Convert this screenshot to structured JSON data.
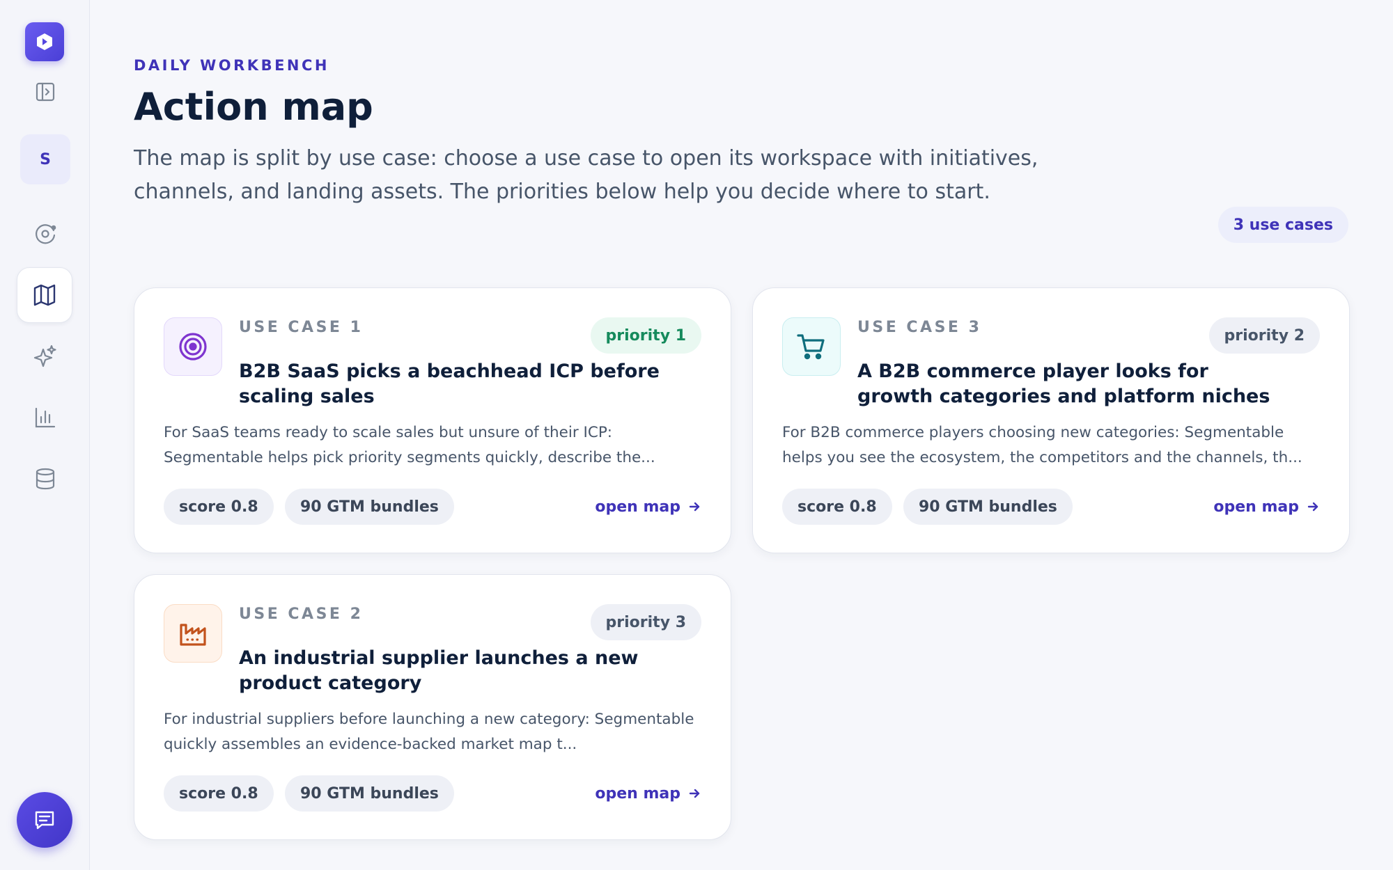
{
  "sidebar": {
    "avatar_initial": "S",
    "icons": [
      "logo-icon",
      "sidebar-toggle-icon",
      "orbit-icon",
      "map-icon",
      "sparkles-icon",
      "bar-chart-icon",
      "database-icon",
      "chat-icon"
    ],
    "active_item": "map"
  },
  "header": {
    "eyebrow": "DAILY WORKBENCH",
    "title": "Action map",
    "intro": "The map is split by use case: choose a use case to open its workspace with initiatives, channels, and landing assets. The priorities below help you decide where to start.",
    "count_badge": "3 use cases"
  },
  "cards": [
    {
      "label": "USE CASE 1",
      "priority": "priority 1",
      "title": "B2B SaaS picks a beachhead ICP before scaling sales",
      "description": "For SaaS teams ready to scale sales but unsure of their ICP: Segmentable helps pick priority segments quickly, describe the...",
      "score": "score 0.8",
      "bundles": "90 GTM bundles",
      "open_label": "open map",
      "icon": "target-icon"
    },
    {
      "label": "USE CASE 3",
      "priority": "priority 2",
      "title": "A B2B commerce player looks for growth categories and platform niches",
      "description": "For B2B commerce players choosing new categories: Segmentable helps you see the ecosystem, the competitors and the channels, th...",
      "score": "score 0.8",
      "bundles": "90 GTM bundles",
      "open_label": "open map",
      "icon": "cart-icon"
    },
    {
      "label": "USE CASE 2",
      "priority": "priority 3",
      "title": "An industrial supplier launches a new product category",
      "description": "For industrial suppliers before launching a new category: Segmentable quickly assembles an evidence-backed market map t...",
      "score": "score 0.8",
      "bundles": "90 GTM bundles",
      "open_label": "open map",
      "icon": "factory-icon"
    }
  ],
  "colors": {
    "accent": "#3f33b8",
    "priority_green": "#158a5c",
    "muted_text": "#475569"
  }
}
